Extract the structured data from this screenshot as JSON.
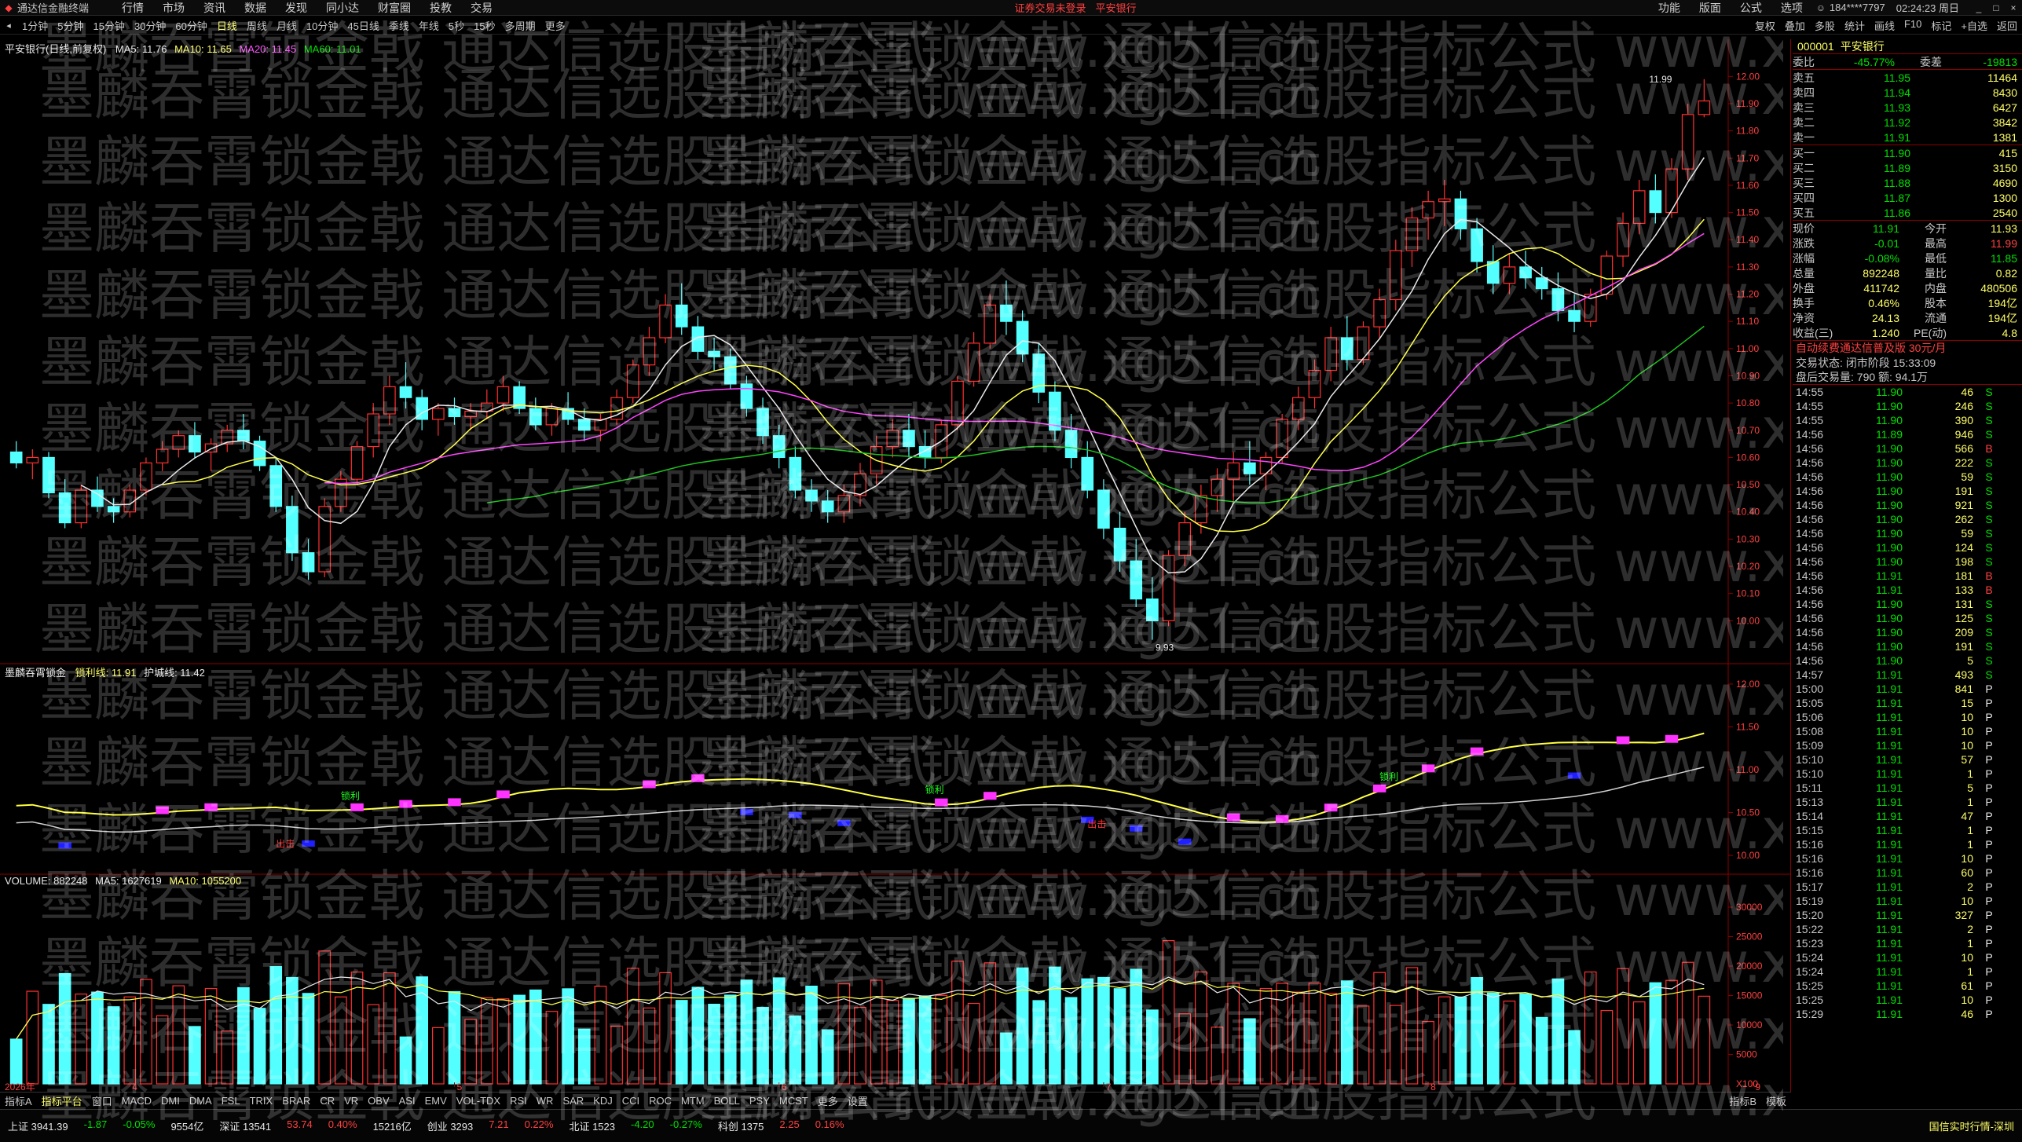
{
  "titlebar": {
    "app_name": "通达信金融终端",
    "menus": [
      "行情",
      "市场",
      "资讯",
      "数据",
      "发现",
      "同小达",
      "财富圈",
      "投教",
      "交易"
    ],
    "notice": "证券交易未登录",
    "stock_notice": "平安银行",
    "right_menus": [
      "功能",
      "版面",
      "公式",
      "选项"
    ],
    "account": "184****7797",
    "time": "02:24:23 周日"
  },
  "periodbar": {
    "periods": [
      "1分钟",
      "5分钟",
      "15分钟",
      "30分钟",
      "60分钟",
      "日线",
      "周线",
      "月线",
      "10分钟",
      "45日线",
      "季线",
      "年线",
      "5秒",
      "15秒",
      "多周期",
      "更多"
    ],
    "active": "日线",
    "tools": [
      "复权",
      "叠加",
      "多股",
      "统计",
      "画线",
      "F10",
      "标记",
      "+自选",
      "返回"
    ]
  },
  "main_panel": {
    "title": "平安银行(日线,前复权)",
    "ma5_label": "MA5: 11.76",
    "ma10_label": "MA10: 11.65",
    "ma20_label": "MA20: 11.45",
    "ma60_label": "MA60: 11.01",
    "y_ticks": [
      "12.00",
      "11.90",
      "11.80",
      "11.70",
      "11.60",
      "11.50",
      "11.40",
      "11.30",
      "11.20",
      "11.10",
      "11.00",
      "10.90",
      "10.80",
      "10.70",
      "10.60",
      "10.50",
      "10.40",
      "10.30",
      "10.20",
      "10.10",
      "10.00"
    ],
    "high_mark": "11.99",
    "low_mark": "9.93"
  },
  "indicator_panel": {
    "title": "墨麟吞霄锁金",
    "line1_label": "锁利线: 11.91",
    "line2_label": "护城线: 11.42",
    "y_ticks": [
      "12.00",
      "11.50",
      "11.00",
      "10.50",
      "10.00"
    ],
    "buy_label": "锁利",
    "sell_label": "出击"
  },
  "volume_panel": {
    "title": "VOLUME: 882248",
    "ma5_label": "MA5: 1627619",
    "ma10_label": "MA10: 1055200",
    "y_ticks": [
      "30000",
      "25000",
      "20000",
      "15000",
      "10000",
      "5000"
    ],
    "unit": "X100"
  },
  "x_axis": {
    "year_label": "2026年",
    "months": [
      "4",
      "5",
      "6",
      "7",
      "8",
      "9"
    ]
  },
  "quote": {
    "code": "000001",
    "name": "平安银行",
    "weibi_label": "委比",
    "weibi": "-45.77%",
    "weicha_label": "委差",
    "weicha": "-19813",
    "asks": [
      {
        "label": "卖五",
        "price": "11.95",
        "vol": "11464"
      },
      {
        "label": "卖四",
        "price": "11.94",
        "vol": "8430"
      },
      {
        "label": "卖三",
        "price": "11.93",
        "vol": "6427"
      },
      {
        "label": "卖二",
        "price": "11.92",
        "vol": "3842"
      },
      {
        "label": "卖一",
        "price": "11.91",
        "vol": "1381"
      }
    ],
    "bids": [
      {
        "label": "买一",
        "price": "11.90",
        "vol": "415"
      },
      {
        "label": "买二",
        "price": "11.89",
        "vol": "3150"
      },
      {
        "label": "买三",
        "price": "11.88",
        "vol": "4690"
      },
      {
        "label": "买四",
        "price": "11.87",
        "vol": "1300"
      },
      {
        "label": "买五",
        "price": "11.86",
        "vol": "2540"
      }
    ],
    "stats": [
      {
        "l1": "现价",
        "v1": "11.91",
        "l2": "今开",
        "v2": "11.93"
      },
      {
        "l1": "涨跌",
        "v1": "-0.01",
        "l2": "最高",
        "v2": "11.99"
      },
      {
        "l1": "涨幅",
        "v1": "-0.08%",
        "l2": "最低",
        "v2": "11.85"
      },
      {
        "l1": "总量",
        "v1": "892248",
        "l2": "量比",
        "v2": "0.82"
      },
      {
        "l1": "外盘",
        "v1": "411742",
        "l2": "内盘",
        "v2": "480506"
      },
      {
        "l1": "换手",
        "v1": "0.46%",
        "l2": "股本",
        "v2": "194亿"
      },
      {
        "l1": "净资",
        "v1": "24.13",
        "l2": "流通",
        "v2": "194亿"
      },
      {
        "l1": "收益(三)",
        "v1": "1.240",
        "l2": "PE(动)",
        "v2": "4.8"
      }
    ],
    "promo": "自动续费通达信普及版 30元/月",
    "trade_state": "交易状态: 闭市阶段 15:33:09",
    "after_hours": "盘后交易量: 790  额: 94.1万"
  },
  "ticks": [
    {
      "t": "14:55",
      "p": "11.90",
      "v": "46",
      "f": "S"
    },
    {
      "t": "14:55",
      "p": "11.90",
      "v": "246",
      "f": "S"
    },
    {
      "t": "14:55",
      "p": "11.90",
      "v": "390",
      "f": "S"
    },
    {
      "t": "14:56",
      "p": "11.89",
      "v": "946",
      "f": "S"
    },
    {
      "t": "14:56",
      "p": "11.90",
      "v": "566",
      "f": "B"
    },
    {
      "t": "14:56",
      "p": "11.90",
      "v": "222",
      "f": "S"
    },
    {
      "t": "14:56",
      "p": "11.90",
      "v": "59",
      "f": "S"
    },
    {
      "t": "14:56",
      "p": "11.90",
      "v": "191",
      "f": "S"
    },
    {
      "t": "14:56",
      "p": "11.90",
      "v": "921",
      "f": "S"
    },
    {
      "t": "14:56",
      "p": "11.90",
      "v": "262",
      "f": "S"
    },
    {
      "t": "14:56",
      "p": "11.90",
      "v": "59",
      "f": "S"
    },
    {
      "t": "14:56",
      "p": "11.90",
      "v": "124",
      "f": "S"
    },
    {
      "t": "14:56",
      "p": "11.90",
      "v": "198",
      "f": "S"
    },
    {
      "t": "14:56",
      "p": "11.91",
      "v": "181",
      "f": "B"
    },
    {
      "t": "14:56",
      "p": "11.91",
      "v": "133",
      "f": "B"
    },
    {
      "t": "14:56",
      "p": "11.90",
      "v": "131",
      "f": "S"
    },
    {
      "t": "14:56",
      "p": "11.90",
      "v": "125",
      "f": "S"
    },
    {
      "t": "14:56",
      "p": "11.90",
      "v": "209",
      "f": "S"
    },
    {
      "t": "14:56",
      "p": "11.90",
      "v": "191",
      "f": "S"
    },
    {
      "t": "14:56",
      "p": "11.90",
      "v": "5",
      "f": "S"
    },
    {
      "t": "14:57",
      "p": "11.91",
      "v": "493",
      "f": "S"
    },
    {
      "t": "15:00",
      "p": "11.91",
      "v": "841",
      "f": "P"
    },
    {
      "t": "15:05",
      "p": "11.91",
      "v": "15",
      "f": "P"
    },
    {
      "t": "15:06",
      "p": "11.91",
      "v": "10",
      "f": "P"
    },
    {
      "t": "15:08",
      "p": "11.91",
      "v": "10",
      "f": "P"
    },
    {
      "t": "15:09",
      "p": "11.91",
      "v": "10",
      "f": "P"
    },
    {
      "t": "15:10",
      "p": "11.91",
      "v": "57",
      "f": "P"
    },
    {
      "t": "15:10",
      "p": "11.91",
      "v": "1",
      "f": "P"
    },
    {
      "t": "15:11",
      "p": "11.91",
      "v": "5",
      "f": "P"
    },
    {
      "t": "15:13",
      "p": "11.91",
      "v": "1",
      "f": "P"
    },
    {
      "t": "15:14",
      "p": "11.91",
      "v": "47",
      "f": "P"
    },
    {
      "t": "15:15",
      "p": "11.91",
      "v": "1",
      "f": "P"
    },
    {
      "t": "15:16",
      "p": "11.91",
      "v": "1",
      "f": "P"
    },
    {
      "t": "15:16",
      "p": "11.91",
      "v": "10",
      "f": "P"
    },
    {
      "t": "15:16",
      "p": "11.91",
      "v": "60",
      "f": "P"
    },
    {
      "t": "15:17",
      "p": "11.91",
      "v": "2",
      "f": "P"
    },
    {
      "t": "15:19",
      "p": "11.91",
      "v": "10",
      "f": "P"
    },
    {
      "t": "15:20",
      "p": "11.91",
      "v": "327",
      "f": "P"
    },
    {
      "t": "15:22",
      "p": "11.91",
      "v": "2",
      "f": "P"
    },
    {
      "t": "15:23",
      "p": "11.91",
      "v": "1",
      "f": "P"
    },
    {
      "t": "15:24",
      "p": "11.91",
      "v": "10",
      "f": "P"
    },
    {
      "t": "15:24",
      "p": "11.91",
      "v": "1",
      "f": "P"
    },
    {
      "t": "15:25",
      "p": "11.91",
      "v": "61",
      "f": "P"
    },
    {
      "t": "15:25",
      "p": "11.91",
      "v": "10",
      "f": "P"
    },
    {
      "t": "15:29",
      "p": "11.91",
      "v": "46",
      "f": "P"
    }
  ],
  "indicator_tabs": {
    "items": [
      "指标A",
      "指标平台",
      "窗口",
      "MACD",
      "DMI",
      "DMA",
      "FSL",
      "TRIX",
      "BRAR",
      "CR",
      "VR",
      "OBV",
      "ASI",
      "EMV",
      "VOL-TDX",
      "RSI",
      "WR",
      "SAR",
      "KDJ",
      "CCI",
      "ROC",
      "MTM",
      "BOLL",
      "PSY",
      "MCST",
      "更多",
      "设置"
    ],
    "right": [
      "指标B",
      "模板"
    ]
  },
  "status_bar": {
    "items": [
      "上证 3941.39",
      "-1.87",
      "-0.05%",
      "9554亿",
      "深证 13541",
      "53.74",
      "0.40%",
      "15216亿",
      "创业 3293",
      "7.21",
      "0.22%",
      "北证 1523",
      "-4.20",
      "-0.27%",
      "科创 1375",
      "2.25",
      "0.16%"
    ],
    "right": "国信实时行情-深圳"
  },
  "watermark_text": "墨麟吞霄锁金戟 通达信选股指标公式 www.xg51.cn",
  "chart_data": {
    "type": "candlestick",
    "title": "平安银行(日线,前复权)",
    "ylim": [
      9.9,
      12.05
    ],
    "candles_ohlc": [
      [
        10.62,
        10.66,
        10.56,
        10.58
      ],
      [
        10.58,
        10.63,
        10.52,
        10.6
      ],
      [
        10.6,
        10.62,
        10.45,
        10.47
      ],
      [
        10.47,
        10.52,
        10.34,
        10.36
      ],
      [
        10.36,
        10.5,
        10.34,
        10.48
      ],
      [
        10.48,
        10.53,
        10.4,
        10.42
      ],
      [
        10.42,
        10.45,
        10.36,
        10.4
      ],
      [
        10.4,
        10.5,
        10.38,
        10.48
      ],
      [
        10.48,
        10.6,
        10.46,
        10.58
      ],
      [
        10.58,
        10.66,
        10.55,
        10.63
      ],
      [
        10.63,
        10.7,
        10.6,
        10.68
      ],
      [
        10.68,
        10.73,
        10.6,
        10.62
      ],
      [
        10.62,
        10.67,
        10.55,
        10.65
      ],
      [
        10.65,
        10.72,
        10.62,
        10.7
      ],
      [
        10.7,
        10.76,
        10.63,
        10.66
      ],
      [
        10.66,
        10.68,
        10.55,
        10.57
      ],
      [
        10.57,
        10.6,
        10.4,
        10.42
      ],
      [
        10.42,
        10.46,
        10.22,
        10.25
      ],
      [
        10.25,
        10.3,
        10.15,
        10.18
      ],
      [
        10.18,
        10.45,
        10.16,
        10.42
      ],
      [
        10.42,
        10.55,
        10.4,
        10.52
      ],
      [
        10.52,
        10.66,
        10.5,
        10.64
      ],
      [
        10.64,
        10.8,
        10.6,
        10.76
      ],
      [
        10.76,
        10.9,
        10.72,
        10.86
      ],
      [
        10.86,
        10.95,
        10.78,
        10.82
      ],
      [
        10.82,
        10.85,
        10.7,
        10.74
      ],
      [
        10.74,
        10.8,
        10.68,
        10.78
      ],
      [
        10.78,
        10.82,
        10.72,
        10.75
      ],
      [
        10.75,
        10.8,
        10.7,
        10.77
      ],
      [
        10.77,
        10.85,
        10.74,
        10.8
      ],
      [
        10.8,
        10.9,
        10.77,
        10.86
      ],
      [
        10.86,
        10.88,
        10.76,
        10.78
      ],
      [
        10.78,
        10.82,
        10.7,
        10.72
      ],
      [
        10.72,
        10.8,
        10.68,
        10.78
      ],
      [
        10.78,
        10.84,
        10.72,
        10.74
      ],
      [
        10.74,
        10.78,
        10.66,
        10.7
      ],
      [
        10.7,
        10.76,
        10.66,
        10.74
      ],
      [
        10.74,
        10.85,
        10.72,
        10.82
      ],
      [
        10.82,
        10.96,
        10.8,
        10.94
      ],
      [
        10.94,
        11.08,
        10.9,
        11.04
      ],
      [
        11.04,
        11.2,
        11.02,
        11.16
      ],
      [
        11.16,
        11.24,
        11.05,
        11.08
      ],
      [
        11.08,
        11.12,
        10.96,
        10.99
      ],
      [
        10.99,
        11.04,
        10.92,
        10.97
      ],
      [
        10.97,
        11.0,
        10.85,
        10.87
      ],
      [
        10.87,
        10.9,
        10.75,
        10.78
      ],
      [
        10.78,
        10.82,
        10.65,
        10.68
      ],
      [
        10.68,
        10.72,
        10.56,
        10.6
      ],
      [
        10.6,
        10.64,
        10.45,
        10.48
      ],
      [
        10.48,
        10.52,
        10.4,
        10.44
      ],
      [
        10.44,
        10.48,
        10.36,
        10.4
      ],
      [
        10.4,
        10.5,
        10.36,
        10.46
      ],
      [
        10.46,
        10.58,
        10.42,
        10.54
      ],
      [
        10.54,
        10.68,
        10.5,
        10.64
      ],
      [
        10.64,
        10.74,
        10.6,
        10.7
      ],
      [
        10.7,
        10.76,
        10.6,
        10.64
      ],
      [
        10.64,
        10.7,
        10.56,
        10.6
      ],
      [
        10.6,
        10.74,
        10.58,
        10.72
      ],
      [
        10.72,
        10.9,
        10.7,
        10.88
      ],
      [
        10.88,
        11.06,
        10.86,
        11.02
      ],
      [
        11.02,
        11.2,
        11.0,
        11.16
      ],
      [
        11.16,
        11.25,
        11.05,
        11.1
      ],
      [
        11.1,
        11.14,
        10.95,
        10.98
      ],
      [
        10.98,
        11.02,
        10.8,
        10.84
      ],
      [
        10.84,
        10.88,
        10.66,
        10.7
      ],
      [
        10.7,
        10.76,
        10.56,
        10.6
      ],
      [
        10.6,
        10.66,
        10.45,
        10.48
      ],
      [
        10.48,
        10.52,
        10.3,
        10.34
      ],
      [
        10.34,
        10.4,
        10.18,
        10.22
      ],
      [
        10.22,
        10.3,
        10.05,
        10.08
      ],
      [
        10.08,
        10.16,
        9.93,
        10.0
      ],
      [
        10.0,
        10.26,
        9.98,
        10.24
      ],
      [
        10.24,
        10.4,
        10.2,
        10.36
      ],
      [
        10.36,
        10.5,
        10.32,
        10.46
      ],
      [
        10.46,
        10.56,
        10.4,
        10.52
      ],
      [
        10.52,
        10.62,
        10.44,
        10.58
      ],
      [
        10.58,
        10.66,
        10.5,
        10.54
      ],
      [
        10.54,
        10.62,
        10.48,
        10.6
      ],
      [
        10.6,
        10.76,
        10.58,
        10.74
      ],
      [
        10.74,
        10.86,
        10.7,
        10.82
      ],
      [
        10.82,
        10.96,
        10.78,
        10.92
      ],
      [
        10.92,
        11.08,
        10.88,
        11.04
      ],
      [
        11.04,
        11.12,
        10.92,
        10.96
      ],
      [
        10.96,
        11.1,
        10.94,
        11.08
      ],
      [
        11.08,
        11.22,
        11.04,
        11.18
      ],
      [
        11.18,
        11.4,
        11.14,
        11.36
      ],
      [
        11.36,
        11.52,
        11.3,
        11.48
      ],
      [
        11.48,
        11.58,
        11.4,
        11.54
      ],
      [
        11.54,
        11.62,
        11.45,
        11.55
      ],
      [
        11.55,
        11.58,
        11.4,
        11.44
      ],
      [
        11.44,
        11.48,
        11.28,
        11.32
      ],
      [
        11.32,
        11.38,
        11.2,
        11.24
      ],
      [
        11.24,
        11.35,
        11.2,
        11.3
      ],
      [
        11.3,
        11.36,
        11.22,
        11.26
      ],
      [
        11.26,
        11.3,
        11.18,
        11.22
      ],
      [
        11.22,
        11.28,
        11.1,
        11.14
      ],
      [
        11.14,
        11.2,
        11.06,
        11.1
      ],
      [
        11.1,
        11.22,
        11.08,
        11.2
      ],
      [
        11.2,
        11.36,
        11.18,
        11.34
      ],
      [
        11.34,
        11.5,
        11.3,
        11.46
      ],
      [
        11.46,
        11.62,
        11.42,
        11.58
      ],
      [
        11.58,
        11.64,
        11.46,
        11.5
      ],
      [
        11.5,
        11.7,
        11.48,
        11.66
      ],
      [
        11.66,
        11.9,
        11.62,
        11.86
      ],
      [
        11.86,
        11.99,
        11.85,
        11.91
      ]
    ]
  }
}
